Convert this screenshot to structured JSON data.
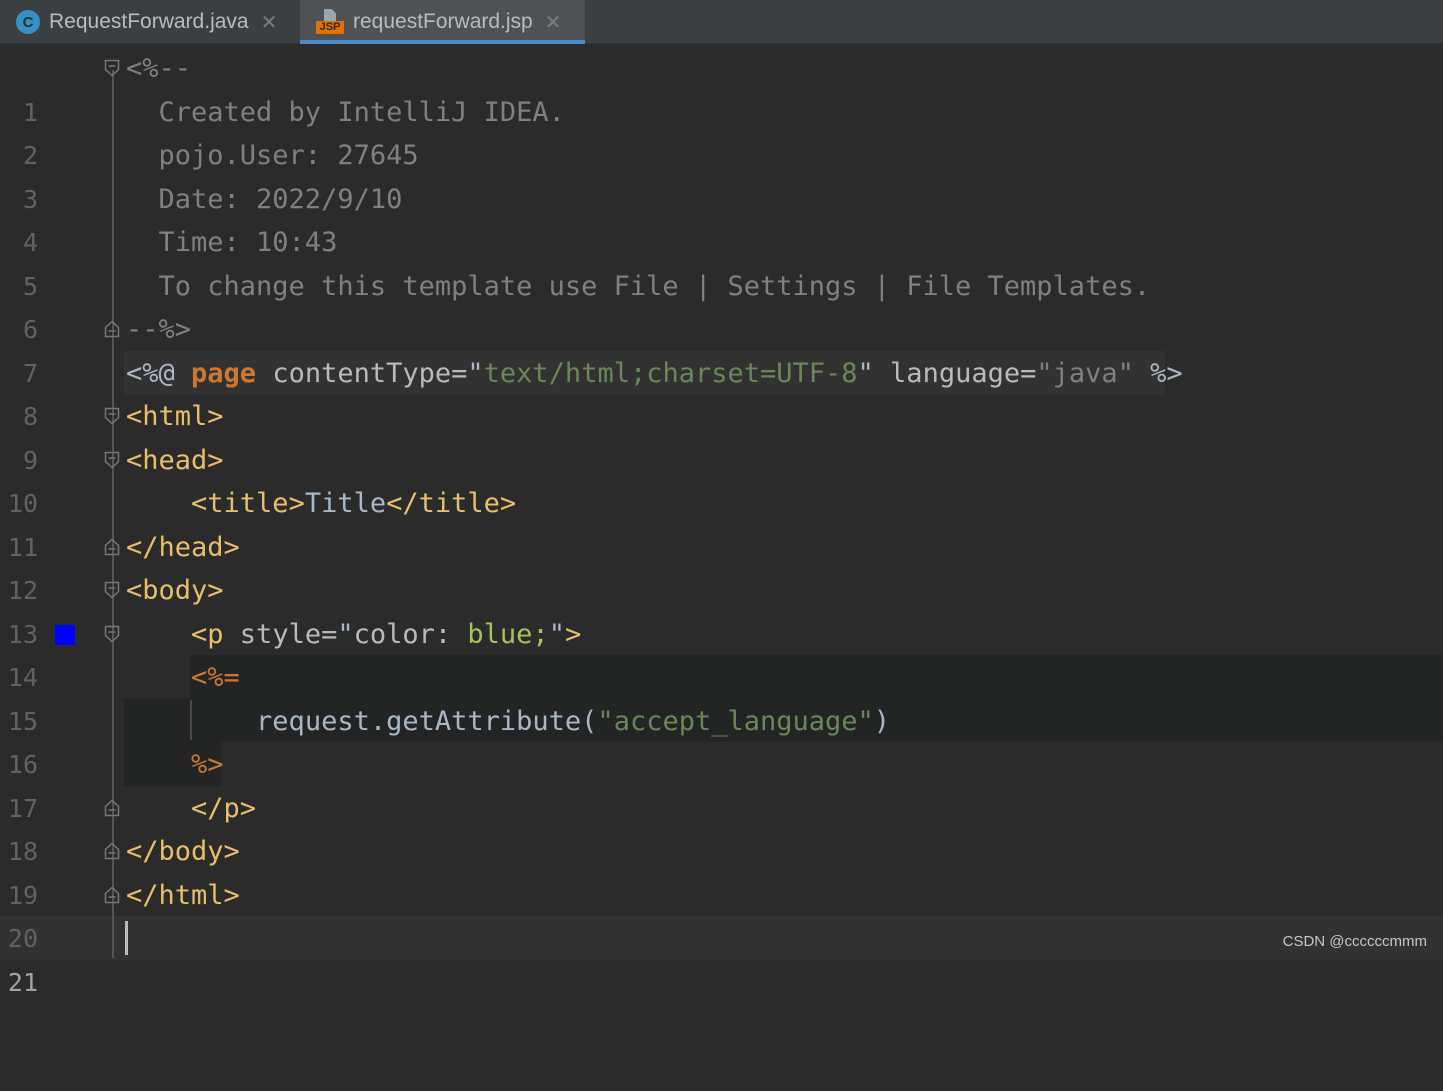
{
  "tabs": [
    {
      "icon": "java-class-icon",
      "icon_letter": "C",
      "label": "RequestForward.java",
      "close": "✕",
      "active": false
    },
    {
      "icon": "jsp-file-icon",
      "icon_badge": "JSP",
      "label": "requestForward.jsp",
      "close": "✕",
      "active": true
    }
  ],
  "editor": {
    "current_line": 21,
    "line_numbers": [
      "1",
      "2",
      "3",
      "4",
      "5",
      "6",
      "7",
      "8",
      "9",
      "10",
      "11",
      "12",
      "13",
      "14",
      "15",
      "16",
      "17",
      "18",
      "19",
      "20",
      "21"
    ],
    "lines": {
      "l1": "<%--",
      "l2": "  Created by IntelliJ IDEA.",
      "l3": "  pojo.User: 27645",
      "l4": "  Date: 2022/9/10",
      "l5": "  Time: 10:43",
      "l6": "  To change this template use File | Settings | File Templates.",
      "l7": "--%>",
      "l8": {
        "open": "<%@ ",
        "kw": "page",
        "a1": " contentType=",
        "q1": "\"",
        "v1": "text/html;charset=UTF-8",
        "q2": "\"",
        "a2": " language=",
        "q3": "\"",
        "v2": "java",
        "q4": "\"",
        "close": " %>"
      },
      "l9": "<html>",
      "l10": "<head>",
      "l11": {
        "indent": "    ",
        "open": "<title>",
        "text": "Title",
        "close": "</title>"
      },
      "l12": "</head>",
      "l13": "<body>",
      "l14": {
        "indent": "    ",
        "open": "<p",
        "attr": " style=",
        "q1": "\"",
        "prop": "color: ",
        "val": "blue;",
        "q2": "\"",
        "close": ">"
      },
      "l15": {
        "indent": "    ",
        "text": "<%="
      },
      "l16": {
        "indent": "        ",
        "call": "request.getAttribute(",
        "q1": "\"",
        "arg": "accept_language",
        "q2": "\"",
        "close": ")"
      },
      "l17": {
        "indent": "    ",
        "text": "%>"
      },
      "l18": {
        "indent": "    ",
        "text": "</p>"
      },
      "l19": "</body>",
      "l20": "</html>",
      "l21": ""
    },
    "color_swatch": "#0000ff"
  },
  "colors": {
    "background": "#2b2b2b",
    "comment": "#808080",
    "tag": "#e8bf6a",
    "keyword": "#cc7832",
    "string": "#6a8759",
    "default": "#a9b7c6",
    "active_tab_underline": "#4a88c7"
  },
  "watermark": "CSDN @ccccccmmm"
}
